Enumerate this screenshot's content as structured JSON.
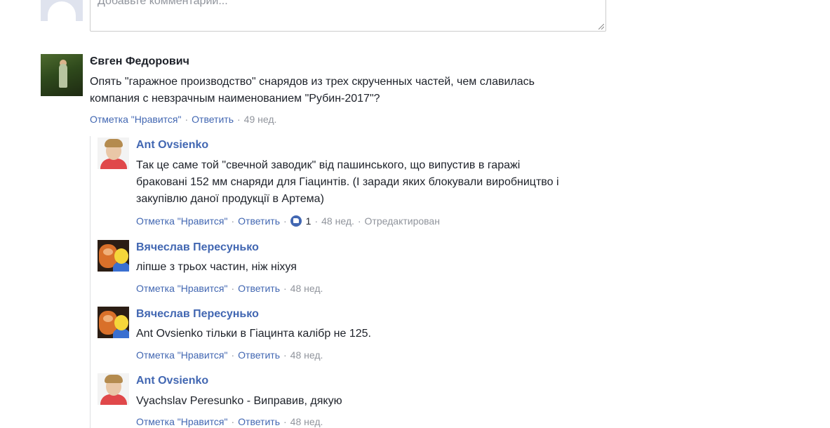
{
  "composer": {
    "placeholder": "Добавьте комментарий..."
  },
  "actions": {
    "like": "Отметка \"Нравится\"",
    "reply": "Ответить",
    "separator": "·"
  },
  "comments": [
    {
      "author": "Євген Федорович",
      "lines": [
        "Опять \"гаражное производство\" снарядов из трех скрученных частей, чем славилась",
        "компания с невзрачным наименованием \"Рубин-2017\"?"
      ],
      "time": "49 нед."
    }
  ],
  "replies": [
    {
      "author": "Ant Ovsienko",
      "lines": [
        "Так це саме той \"свечной заводик\" від пашинського, що випустив в гаражі",
        "браковані 152 мм снаряди для Гіацинтів. (І заради яких блокували виробництво і",
        "закупівлю даної продукції в Артема)"
      ],
      "likes": "1",
      "time": "48 нед.",
      "edited": "Отредактирован"
    },
    {
      "author": "Вячеслав Пересунько",
      "lines": [
        "ліпше з трьох частин, ніж ніхуя"
      ],
      "time": "48 нед."
    },
    {
      "author": "Вячеслав Пересунько",
      "lines": [
        "Ant Ovsienko тільки в Гіацинта калібр не 125."
      ],
      "time": "48 нед."
    },
    {
      "author": "Ant Ovsienko",
      "lines": [
        "Vyachslav Peresunko - Виправив, дякую"
      ],
      "time": "48 нед."
    }
  ],
  "colors": {
    "link": "#4267b2",
    "meta": "#90949c",
    "text": "#1d2129"
  }
}
